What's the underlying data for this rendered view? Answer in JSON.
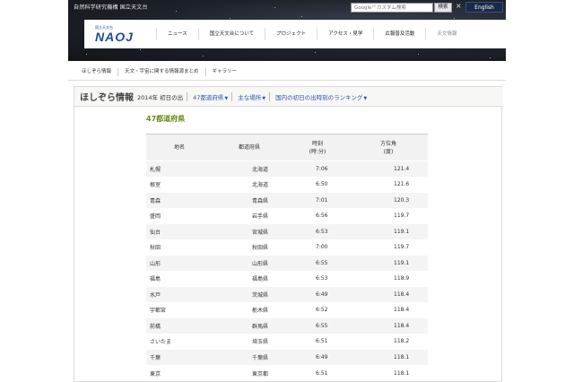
{
  "header": {
    "org_name": "自然科学研究機構 国立天文台",
    "search_placeholder": "Google™カスタム検索",
    "search_button": "検索",
    "close_symbol": "×",
    "english_button": "English",
    "logo_small": "国立天文台",
    "logo_main": "NAOJ",
    "nav_items": [
      "ニュース",
      "国立天文台について",
      "プロジェクト",
      "アクセス・見学",
      "広報普及活動",
      "天文情報"
    ]
  },
  "subnav": {
    "items": [
      "ほしぞら情報",
      "天文・宇宙に関する情報源まとめ",
      "ギャラリー"
    ]
  },
  "page": {
    "section_title": "ほしぞら情報",
    "year_label": "2014年 初日の出",
    "dropdowns": [
      "47都道府県",
      "主な場所",
      "国内の初日の出時刻のランキング"
    ],
    "caret": "▼",
    "heading": "47都道府県"
  },
  "table": {
    "headers": {
      "place": "地名",
      "prefecture": "都道府県",
      "time_line1": "時刻",
      "time_line2": "(時:分)",
      "azimuth_line1": "方位角",
      "azimuth_line2": "(度)"
    },
    "rows": [
      {
        "place": "札幌",
        "prefecture": "北海道",
        "time": "7:06",
        "azimuth": "121.4"
      },
      {
        "place": "根室",
        "prefecture": "北海道",
        "time": "6:50",
        "azimuth": "121.6"
      },
      {
        "place": "青森",
        "prefecture": "青森県",
        "time": "7:01",
        "azimuth": "120.3"
      },
      {
        "place": "盛岡",
        "prefecture": "岩手県",
        "time": "6:56",
        "azimuth": "119.7"
      },
      {
        "place": "仙台",
        "prefecture": "宮城県",
        "time": "6:53",
        "azimuth": "119.1"
      },
      {
        "place": "秋田",
        "prefecture": "秋田県",
        "time": "7:00",
        "azimuth": "119.7"
      },
      {
        "place": "山形",
        "prefecture": "山形県",
        "time": "6:55",
        "azimuth": "119.1"
      },
      {
        "place": "福島",
        "prefecture": "福島県",
        "time": "6:53",
        "azimuth": "118.9"
      },
      {
        "place": "水戸",
        "prefecture": "茨城県",
        "time": "6:49",
        "azimuth": "118.4"
      },
      {
        "place": "宇都宮",
        "prefecture": "栃木県",
        "time": "6:52",
        "azimuth": "118.4"
      },
      {
        "place": "前橋",
        "prefecture": "群馬県",
        "time": "6:55",
        "azimuth": "118.4"
      },
      {
        "place": "さいたま",
        "prefecture": "埼玉県",
        "time": "6:51",
        "azimuth": "118.2"
      },
      {
        "place": "千葉",
        "prefecture": "千葉県",
        "time": "6:49",
        "azimuth": "118.1"
      },
      {
        "place": "東京",
        "prefecture": "東京都",
        "time": "6:51",
        "azimuth": "118.1"
      }
    ]
  },
  "colors": {
    "heading_green": "#6a8a1e",
    "link_blue": "#2a56b7",
    "english_button_bg": "#1b2a4a",
    "logo_blue": "#1d4e8f"
  }
}
